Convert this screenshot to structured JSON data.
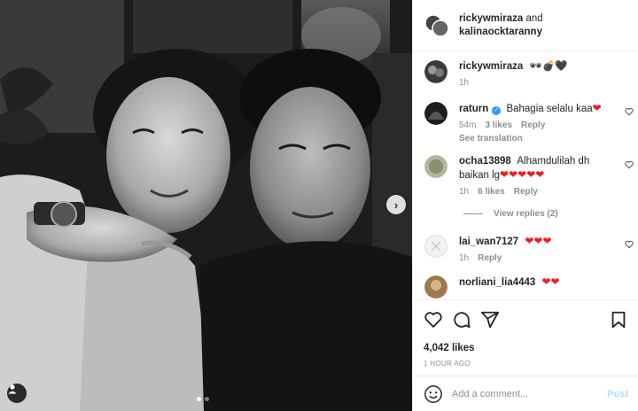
{
  "post": {
    "header": {
      "user1": "rickywmiraza",
      "conj": "and",
      "user2": "kalinaocktaranny"
    },
    "caption": {
      "user": "rickywmiraza",
      "text": "🕶💣🖤",
      "time": "1h"
    },
    "comments": [
      {
        "user": "raturn",
        "verified": true,
        "text": "Bahagia selalu kaa",
        "hearts": "❤",
        "time": "54m",
        "likes": "3 likes",
        "reply": "Reply",
        "see_translation": "See translation"
      },
      {
        "user": "ocha13898",
        "text": "Alhamdulilah dh baikan lg",
        "hearts": "❤❤❤❤❤",
        "time": "1h",
        "likes": "6 likes",
        "reply": "Reply",
        "view_replies": "View replies (2)"
      },
      {
        "user": "lai_wan7127",
        "text": "",
        "hearts": "❤❤❤",
        "time": "1h",
        "reply": "Reply"
      },
      {
        "user": "norliani_lia4443",
        "text": "",
        "hearts": "❤❤",
        "time": "",
        "reply": ""
      }
    ],
    "likes_count": "4,042 likes",
    "time_ago": "1 HOUR AGO",
    "comment_input": {
      "placeholder": "Add a comment...",
      "post_label": "Post"
    },
    "arrow": "›",
    "carousel_index": 1,
    "carousel_total": 2,
    "colors": {
      "heart": "#ed1d24",
      "verified": "#3897f0",
      "post_disabled": "#b2dffc",
      "muted": "#8e8e8e"
    }
  }
}
